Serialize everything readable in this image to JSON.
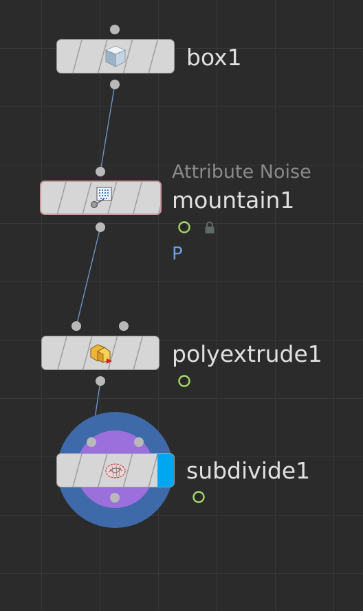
{
  "network": {
    "nodes": [
      {
        "id": "box1",
        "name": "box1",
        "icon": "cube-icon"
      },
      {
        "id": "mountain1",
        "name": "mountain1",
        "type_label": "Attribute Noise",
        "icon": "noise-icon",
        "badges": [
          "time-dependent-icon",
          "lock-icon"
        ],
        "attribute": "P",
        "selected": true
      },
      {
        "id": "polyextrude1",
        "name": "polyextrude1",
        "icon": "polyextrude-icon",
        "badges": [
          "time-dependent-icon"
        ]
      },
      {
        "id": "subdivide1",
        "name": "subdivide1",
        "icon": "subdivide-icon",
        "badges": [
          "time-dependent-icon"
        ],
        "display_flag": true,
        "render_flag": true
      }
    ],
    "wires": [
      {
        "from": "box1",
        "to": "mountain1"
      },
      {
        "from": "mountain1",
        "to": "polyextrude1"
      },
      {
        "from": "polyextrude1",
        "to": "subdivide1"
      }
    ]
  },
  "colors": {
    "background": "#2b2b2b",
    "grid": "#383838",
    "node_body": "#d6d6d6",
    "port": "#b9b9b9",
    "wire": "#6f93c6",
    "label": "#e0e0e0",
    "type_label": "#8a8a8a",
    "attribute": "#6e9de0",
    "selected_outline": "#c99a9e",
    "display_flag": "#00a6ef",
    "display_ring": "#3f6aa9",
    "render_ring": "#9b6fdc",
    "time_badge": "#a6d86a"
  }
}
